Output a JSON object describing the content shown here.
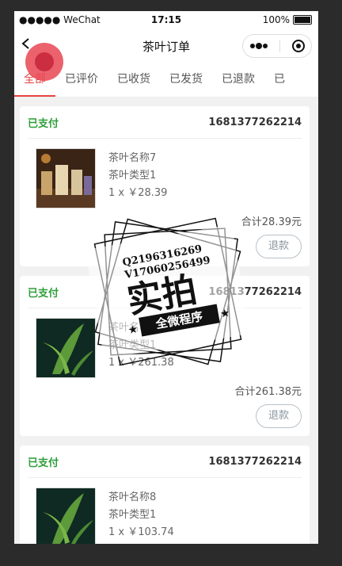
{
  "status_bar": {
    "carrier": "●●●●● WeChat",
    "time": "17:15",
    "battery": "100%"
  },
  "nav": {
    "title": "茶叶订单"
  },
  "tabs": [
    "全部",
    "已评价",
    "已收货",
    "已发货",
    "已退款",
    "已"
  ],
  "orders": [
    {
      "status": "已支付",
      "order_no": "1681377262214",
      "name": "茶叶名称7",
      "type": "茶叶类型1",
      "qty_price": "1 x ￥28.39",
      "total": "合计28.39元",
      "refund": "退款",
      "image": "boxed-tea-photo"
    },
    {
      "status": "已支付",
      "order_no": "1681377262214",
      "name": "茶叶名称11",
      "type": "茶叶类型1",
      "qty_price": "1 x ￥261.38",
      "total": "合计261.38元",
      "refund": "退款",
      "image": "tea-leaf-photo"
    },
    {
      "status": "已支付",
      "order_no": "1681377262214",
      "name": "茶叶名称8",
      "type": "茶叶类型1",
      "qty_price": "1 x ￥103.74",
      "total": "",
      "refund": "",
      "image": "tea-leaf-photo"
    }
  ],
  "watermark": {
    "line1": "Q2196316269",
    "line2": "V17060256499",
    "main": "实拍",
    "banner": "全微程序"
  },
  "colors": {
    "status_green": "#2e9e3a",
    "tab_active": "#e64340",
    "page_bg": "#f1f1f1"
  }
}
